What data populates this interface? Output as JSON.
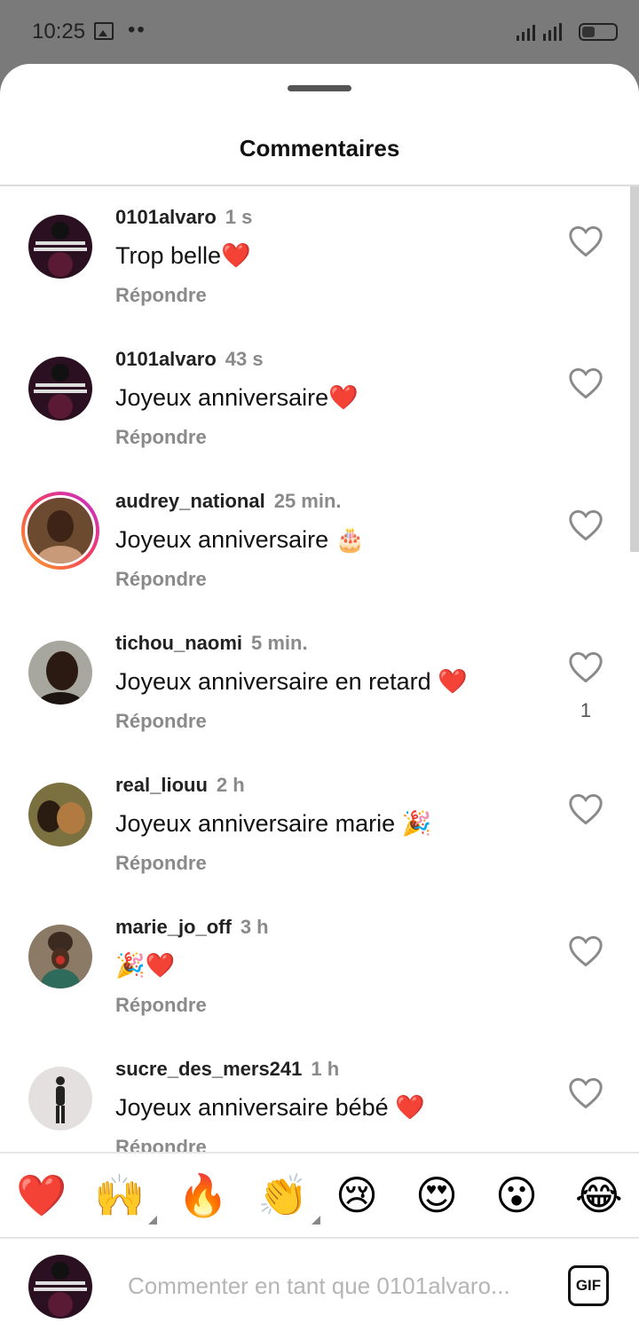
{
  "status_bar": {
    "time": "10:25",
    "dots": "••"
  },
  "sheet": {
    "title": "Commentaires"
  },
  "comments": [
    {
      "username": "0101alvaro",
      "time": "1 s",
      "text": "Trop belle❤️",
      "reply": "Répondre",
      "likes": ""
    },
    {
      "username": "0101alvaro",
      "time": "43 s",
      "text": "Joyeux anniversaire❤️",
      "reply": "Répondre",
      "likes": ""
    },
    {
      "username": "audrey_national",
      "time": "25 min.",
      "text": "Joyeux anniversaire 🎂",
      "reply": "Répondre",
      "likes": ""
    },
    {
      "username": "tichou_naomi",
      "time": "5 min.",
      "text": "Joyeux anniversaire en retard ❤️",
      "reply": "Répondre",
      "likes": "1"
    },
    {
      "username": "real_liouu",
      "time": "2 h",
      "text": "Joyeux anniversaire marie 🎉",
      "reply": "Répondre",
      "likes": ""
    },
    {
      "username": "marie_jo_off",
      "time": "3 h",
      "text": "🎉❤️",
      "reply": "Répondre",
      "likes": ""
    },
    {
      "username": "sucre_des_mers241",
      "time": "1 h",
      "text": "Joyeux anniversaire bébé ❤️",
      "reply": "Répondre",
      "likes": ""
    }
  ],
  "quick_reactions": [
    "❤️",
    "🙌",
    "🔥",
    "👏",
    "😢",
    "😍",
    "😮",
    "😂"
  ],
  "compose": {
    "placeholder": "Commenter en tant que 0101alvaro...",
    "gif_label": "GIF"
  },
  "colors": {
    "secondary_text": "#8a8a8a",
    "story_ring": [
      "#f9a825",
      "#f5405a",
      "#c22bd9"
    ]
  }
}
